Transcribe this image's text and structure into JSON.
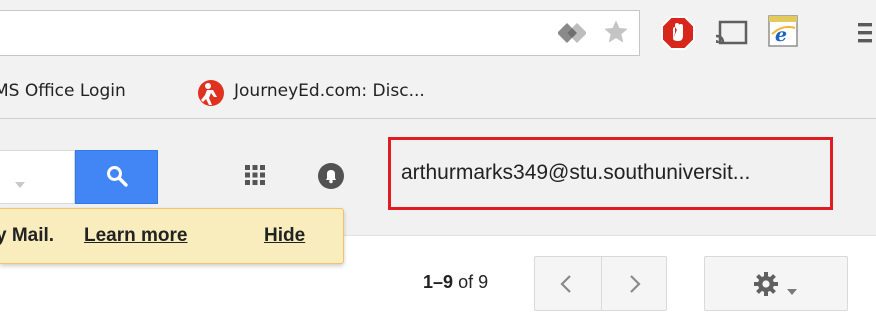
{
  "bookmarks": {
    "items": [
      {
        "label": "MS Office Login",
        "icon": "bookmark-page"
      },
      {
        "label": "JourneyEd.com: Disc...",
        "icon": "journeyed-logo"
      }
    ]
  },
  "toolbar": {
    "extensions": [
      "translate-icon",
      "star-icon",
      "adblock-icon",
      "cast-icon",
      "ie-tab-icon",
      "menu-icon"
    ]
  },
  "gmail": {
    "search_icon": "search-icon",
    "apps_icon": "apps-grid-icon",
    "notifications_icon": "notifications-icon",
    "account_email": "arthurmarks349@stu.southuniversit...",
    "notice": {
      "text": "y Mail.",
      "learn_more": "Learn more",
      "hide": "Hide"
    },
    "pagination": {
      "range": "1–9",
      "of_label": "of",
      "total": "9"
    }
  },
  "colors": {
    "search_button": "#4285f4",
    "highlight_border": "#e01b24",
    "notice_bg": "#f9edbe",
    "adblock_red": "#d7261b"
  }
}
